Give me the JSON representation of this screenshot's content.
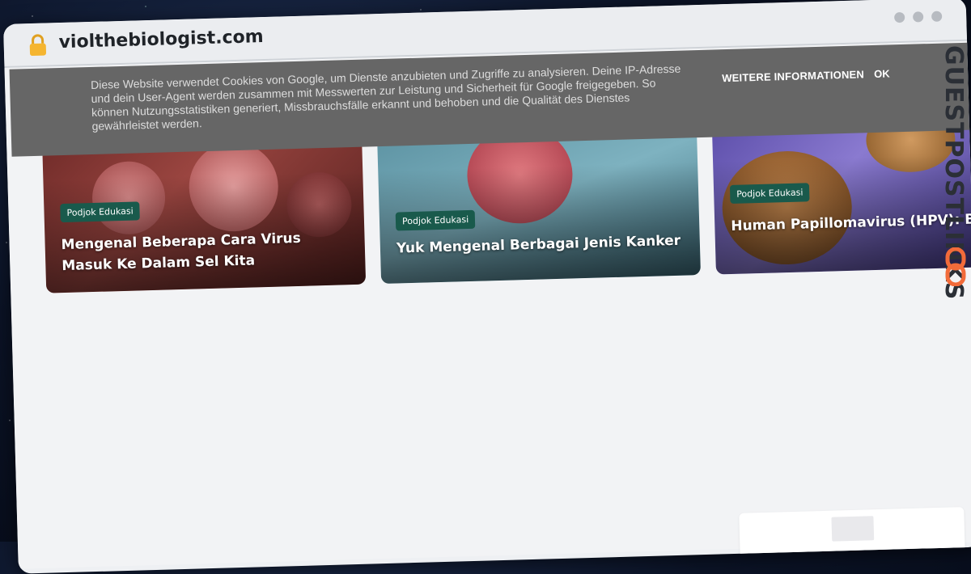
{
  "browser": {
    "url": "violthebiologist.com",
    "icons": {
      "lock": "lock-icon"
    }
  },
  "cookie_banner": {
    "text": "Diese Website verwendet Cookies von Google, um Dienste anzubieten und Zugriffe zu analysieren. Deine IP-Adresse und dein User-Agent werden zusammen mit Messwerten zur Leistung und Sicherheit für Google freigegeben. So können Nutzungsstatistiken generiert, Missbrauchsfälle erkannt und behoben und die Qualität des Dienstes gewährleistet werden.",
    "more_label": "WEITERE INFORMATIONEN",
    "ok_label": "OK"
  },
  "featured": [
    {
      "tag": "Podjok Edukasi",
      "title": "Mengenal Beberapa Cara Virus Masuk Ke Dalam Sel Kita"
    },
    {
      "tag": "Podjok Edukasi",
      "title": "Yuk Mengenal Berbagai Jenis Kanker"
    },
    {
      "tag": "Podjok Edukasi",
      "title": "Human Papillomavirus (HPV): Biologi Molekuler dan Cara Dia Memicu K"
    }
  ],
  "carousel": {
    "next_icon": "chevron-right-icon",
    "next_glyph": "›"
  },
  "watermark": {
    "text": "GUESTPOSTLINKS"
  },
  "colors": {
    "cookie_bg": "#666666",
    "tag_bg": "#195a4c",
    "page_bg": "#f2f3f5",
    "brand_accent": "#f26b3a"
  }
}
